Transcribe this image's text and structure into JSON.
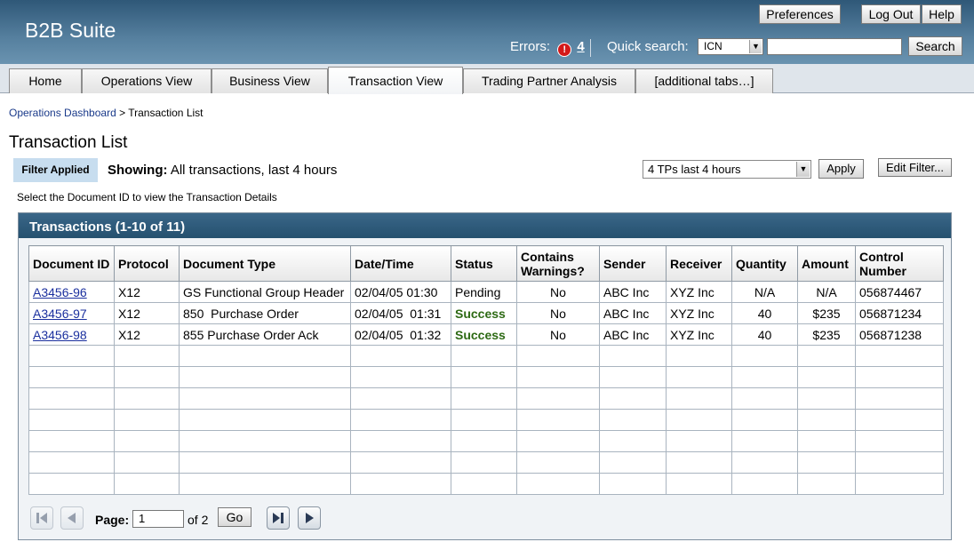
{
  "app": {
    "title": "B2B Suite",
    "preferences": "Preferences",
    "logout": "Log Out",
    "help": "Help",
    "errors_label": "Errors:",
    "errors_icon": "!",
    "errors_count": "4",
    "quick_search_label": "Quick search:",
    "quick_search_type": "ICN",
    "quick_search_value": "",
    "search_button": "Search"
  },
  "tabs": [
    {
      "label": "Home"
    },
    {
      "label": "Operations View"
    },
    {
      "label": "Business View"
    },
    {
      "label": "Transaction View",
      "active": true
    },
    {
      "label": "Trading Partner Analysis"
    },
    {
      "label": "[additional tabs…]"
    }
  ],
  "breadcrumb": {
    "link": "Operations Dashboard",
    "separator": ">",
    "current": "Transaction List"
  },
  "page": {
    "title": "Transaction List",
    "filter_badge": "Filter Applied",
    "showing_label": "Showing:",
    "showing_text": "All transactions, last 4 hours",
    "filter_select": "4 TPs last 4 hours",
    "apply_button": "Apply",
    "edit_filter_button": "Edit Filter...",
    "instruction": "Select the Document ID to view the Transaction Details"
  },
  "panel": {
    "title": "Transactions (1-10 of 11)",
    "columns": [
      {
        "label": "Document ID"
      },
      {
        "label": "Protocol"
      },
      {
        "label": "Document Type"
      },
      {
        "label": "Date/Time"
      },
      {
        "label": "Status"
      },
      {
        "label": "Contains Warnings?"
      },
      {
        "label": "Sender"
      },
      {
        "label": "Receiver"
      },
      {
        "label": "Quantity"
      },
      {
        "label": "Amount"
      },
      {
        "label": "Control Number"
      }
    ],
    "rows": [
      {
        "doc_id": "A3456-96",
        "protocol": "X12",
        "doc_type": "GS Functional Group Header",
        "datetime": "02/04/05 01:30",
        "status": "Pending",
        "warnings": "No",
        "sender": "ABC Inc",
        "receiver": "XYZ Inc",
        "quantity": "N/A",
        "amount": "N/A",
        "control": "056874467"
      },
      {
        "doc_id": "A3456-97",
        "protocol": "X12",
        "doc_type": "850  Purchase Order",
        "datetime": "02/04/05  01:31",
        "status": "Success",
        "warnings": "No",
        "sender": "ABC Inc",
        "receiver": "XYZ Inc",
        "quantity": "40",
        "amount": "$235",
        "control": "056871234"
      },
      {
        "doc_id": "A3456-98",
        "protocol": "X12",
        "doc_type": "855 Purchase Order Ack",
        "datetime": "02/04/05  01:32",
        "status": "Success",
        "warnings": "No",
        "sender": "ABC Inc",
        "receiver": "XYZ Inc",
        "quantity": "40",
        "amount": "$235",
        "control": "056871238"
      }
    ],
    "empty_rows": 7
  },
  "pager": {
    "page_label": "Page:",
    "current_page": "1",
    "of_label": "of",
    "total_pages": "2",
    "go_button": "Go",
    "icons": [
      "first-page-icon",
      "prev-page-icon",
      "last-page-icon",
      "next-page-icon"
    ]
  },
  "colors": {
    "header": "#2f5878",
    "panel_header": "#2f5c7e",
    "success": "#2d6a14",
    "link": "#1a2f9e",
    "error_badge": "#d41a1a"
  }
}
